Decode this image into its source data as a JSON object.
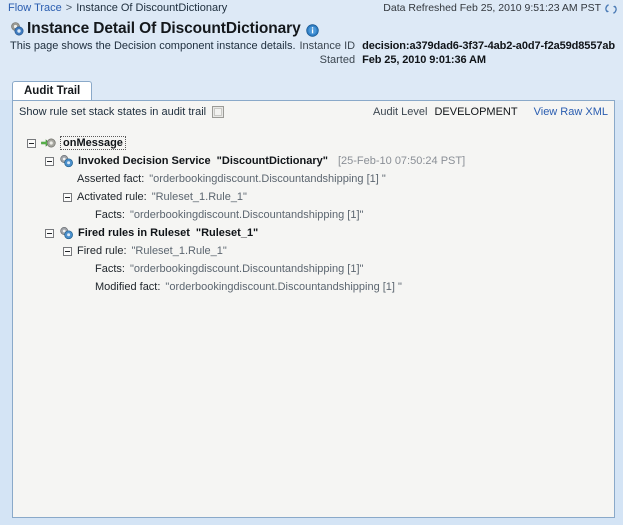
{
  "breadcrumb": {
    "parent": "Flow Trace",
    "separator": ">",
    "current": "Instance Of DiscountDictionary"
  },
  "header": {
    "refresh_text": "Data Refreshed Feb 25, 2010 9:51:23 AM PST",
    "refresh_icon": "refresh-icon",
    "title_icon": "decision-component-icon",
    "title": "Instance Detail Of DiscountDictionary",
    "info_icon": "info-icon",
    "subtitle": "This page shows the Decision component instance details.",
    "meta": [
      {
        "label": "Instance ID",
        "value": "decision:a379dad6-3f37-4ab2-a0d7-f2a59d8557ab"
      },
      {
        "label": "Started",
        "value": "Feb 25, 2010 9:01:36 AM"
      }
    ]
  },
  "tabs": [
    {
      "label": "Audit Trail",
      "selected": true
    }
  ],
  "toolbar": {
    "checkbox_label": "Show rule set stack states in audit trail",
    "checkbox_checked": false,
    "audit_level_label": "Audit Level",
    "audit_level_value": "DEVELOPMENT",
    "view_raw_xml": "View Raw XML"
  },
  "tree": [
    {
      "indent": 0,
      "expander": "expanded",
      "icon": "on-message-icon",
      "label": "onMessage",
      "style": "focus"
    },
    {
      "indent": 1,
      "expander": "expanded",
      "icon": "decision-service-icon",
      "label": "Invoked Decision Service",
      "quoted": "\"DiscountDictionary\"",
      "timestamp": "[25-Feb-10 07:50:24 PST]",
      "style": "bold"
    },
    {
      "indent": 2,
      "expander": "none",
      "label": "Asserted fact:",
      "value": "\"orderbookingdiscount.Discountandshipping [1] \"",
      "style": "plain"
    },
    {
      "indent": 2,
      "expander": "expanded",
      "label": "Activated rule:",
      "value": "\"Ruleset_1.Rule_1\"",
      "style": "plain"
    },
    {
      "indent": 3,
      "expander": "none",
      "label": "Facts:",
      "value": "\"orderbookingdiscount.Discountandshipping [1]\"",
      "style": "plain"
    },
    {
      "indent": 1,
      "expander": "expanded",
      "icon": "decision-service-icon",
      "label": "Fired rules in Ruleset",
      "quoted": "\"Ruleset_1\"",
      "style": "bold"
    },
    {
      "indent": 2,
      "expander": "expanded",
      "label": "Fired rule:",
      "value": "\"Ruleset_1.Rule_1\"",
      "style": "plain"
    },
    {
      "indent": 3,
      "expander": "none",
      "label": "Facts:",
      "value": "\"orderbookingdiscount.Discountandshipping [1]\"",
      "style": "plain"
    },
    {
      "indent": 3,
      "expander": "none",
      "label": "Modified fact:",
      "value": "\"orderbookingdiscount.Discountandshipping [1] \"",
      "style": "plain"
    }
  ],
  "colors": {
    "page_background": "#d4e4f5",
    "header_background": "#dde9f6",
    "panel_background": "#f5f5f3",
    "panel_border": "#8aa9c9",
    "link": "#2a5db0",
    "value_text": "#5c6670",
    "timestamp_text": "#8a8f96"
  }
}
